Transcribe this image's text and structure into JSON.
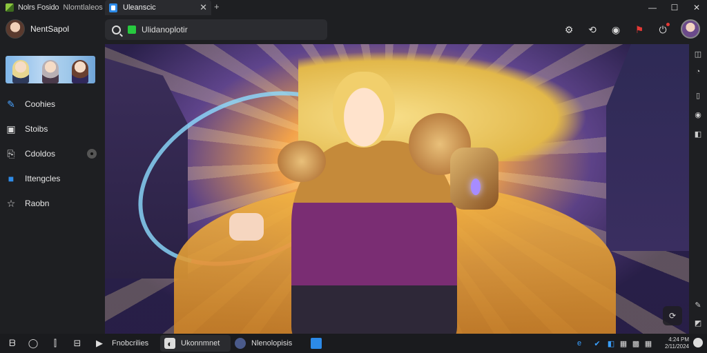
{
  "titlebar": {
    "app_name": "Nolrs Fosido",
    "app_sub": "Nlomtlaleos",
    "tab_label": "Uleanscic",
    "tab_close": "✕",
    "tab_new": "+",
    "minimize": "—",
    "maximize": "☐",
    "close": "✕"
  },
  "sidebar": {
    "profile_name": "NentSapol",
    "items": [
      {
        "label": "Coohies",
        "icon": "brush-icon",
        "glyph": "✎"
      },
      {
        "label": "Stoibs",
        "icon": "box-icon",
        "glyph": "▣"
      },
      {
        "label": "Cdoldos",
        "icon": "document-icon",
        "glyph": "⎘"
      },
      {
        "label": "Ittengcles",
        "icon": "folder-icon",
        "glyph": "■"
      },
      {
        "label": "Raobn",
        "icon": "star-icon",
        "glyph": "☆"
      }
    ]
  },
  "toolbar": {
    "search_value": "Ulidanoplotir",
    "icons": [
      {
        "name": "settings-icon",
        "glyph": "⚙"
      },
      {
        "name": "share-icon",
        "glyph": "⟲"
      },
      {
        "name": "record-icon",
        "glyph": "◉"
      },
      {
        "name": "alert-icon",
        "glyph": "⚑"
      },
      {
        "name": "power-icon",
        "glyph": "⏻"
      }
    ]
  },
  "canvas": {
    "overlay_button": "⟳"
  },
  "rail": {
    "icons": [
      "◫",
      "◔",
      "▯",
      "◉",
      "◧",
      "✎",
      "◩"
    ]
  },
  "taskbar": {
    "labels": {
      "app1": "Fnobcrilies",
      "app2": "Ukonnmnet",
      "app3": "Nlenolopisis"
    },
    "left_icons": [
      "ᗷ",
      "◯",
      "⫿",
      "⊟",
      "▶"
    ],
    "tray": [
      "e",
      "✔",
      "◧",
      "▦",
      "▩",
      "▦"
    ],
    "clock_top": "4:24 PM",
    "clock_bottom": "2/11/2024"
  }
}
